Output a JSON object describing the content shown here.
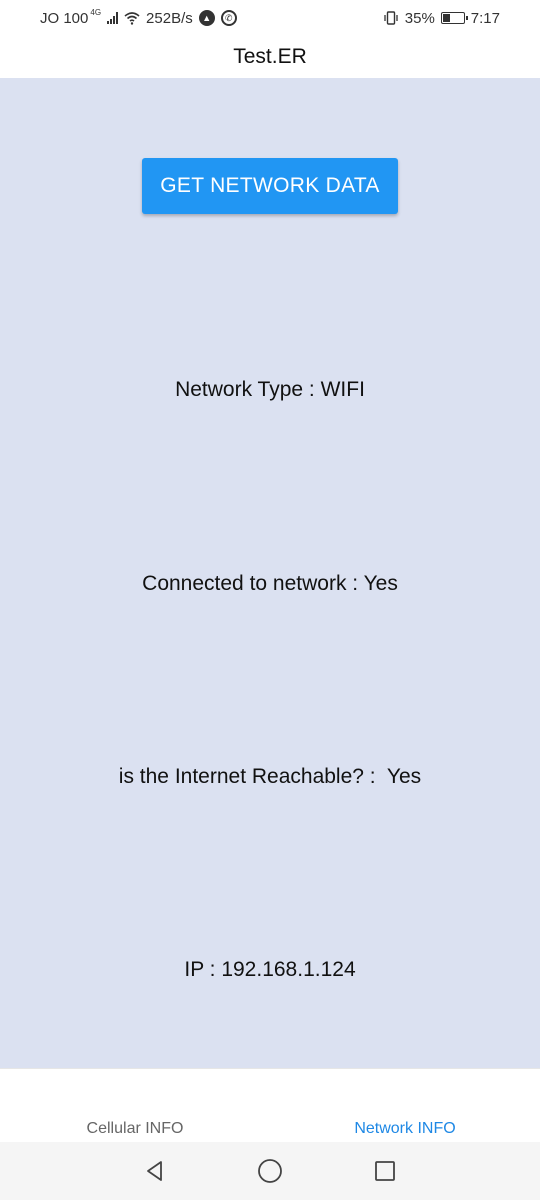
{
  "status_bar": {
    "carrier": "JO 100",
    "network_gen": "4G",
    "speed": "252B/s",
    "battery": "35%",
    "time": "7:17"
  },
  "header": {
    "title": "Test.ER"
  },
  "main": {
    "button_label": "GET NETWORK DATA",
    "network_type": "Network Type : WIFI",
    "connected": "Connected to network : Yes",
    "reachable": "is the Internet Reachable? :  Yes",
    "ip": "IP : 192.168.1.124"
  },
  "tabs": [
    {
      "label": "Cellular INFO",
      "active": false
    },
    {
      "label": "Network INFO",
      "active": true
    }
  ],
  "colors": {
    "accent": "#2196f3",
    "background": "#dbe1f1",
    "active_tab": "#1e88e5"
  },
  "icons": [
    "wifi-icon",
    "signal-icon",
    "app-icon",
    "whatsapp-icon",
    "vibrate-icon",
    "battery-icon",
    "back-icon",
    "home-icon",
    "recents-icon"
  ]
}
